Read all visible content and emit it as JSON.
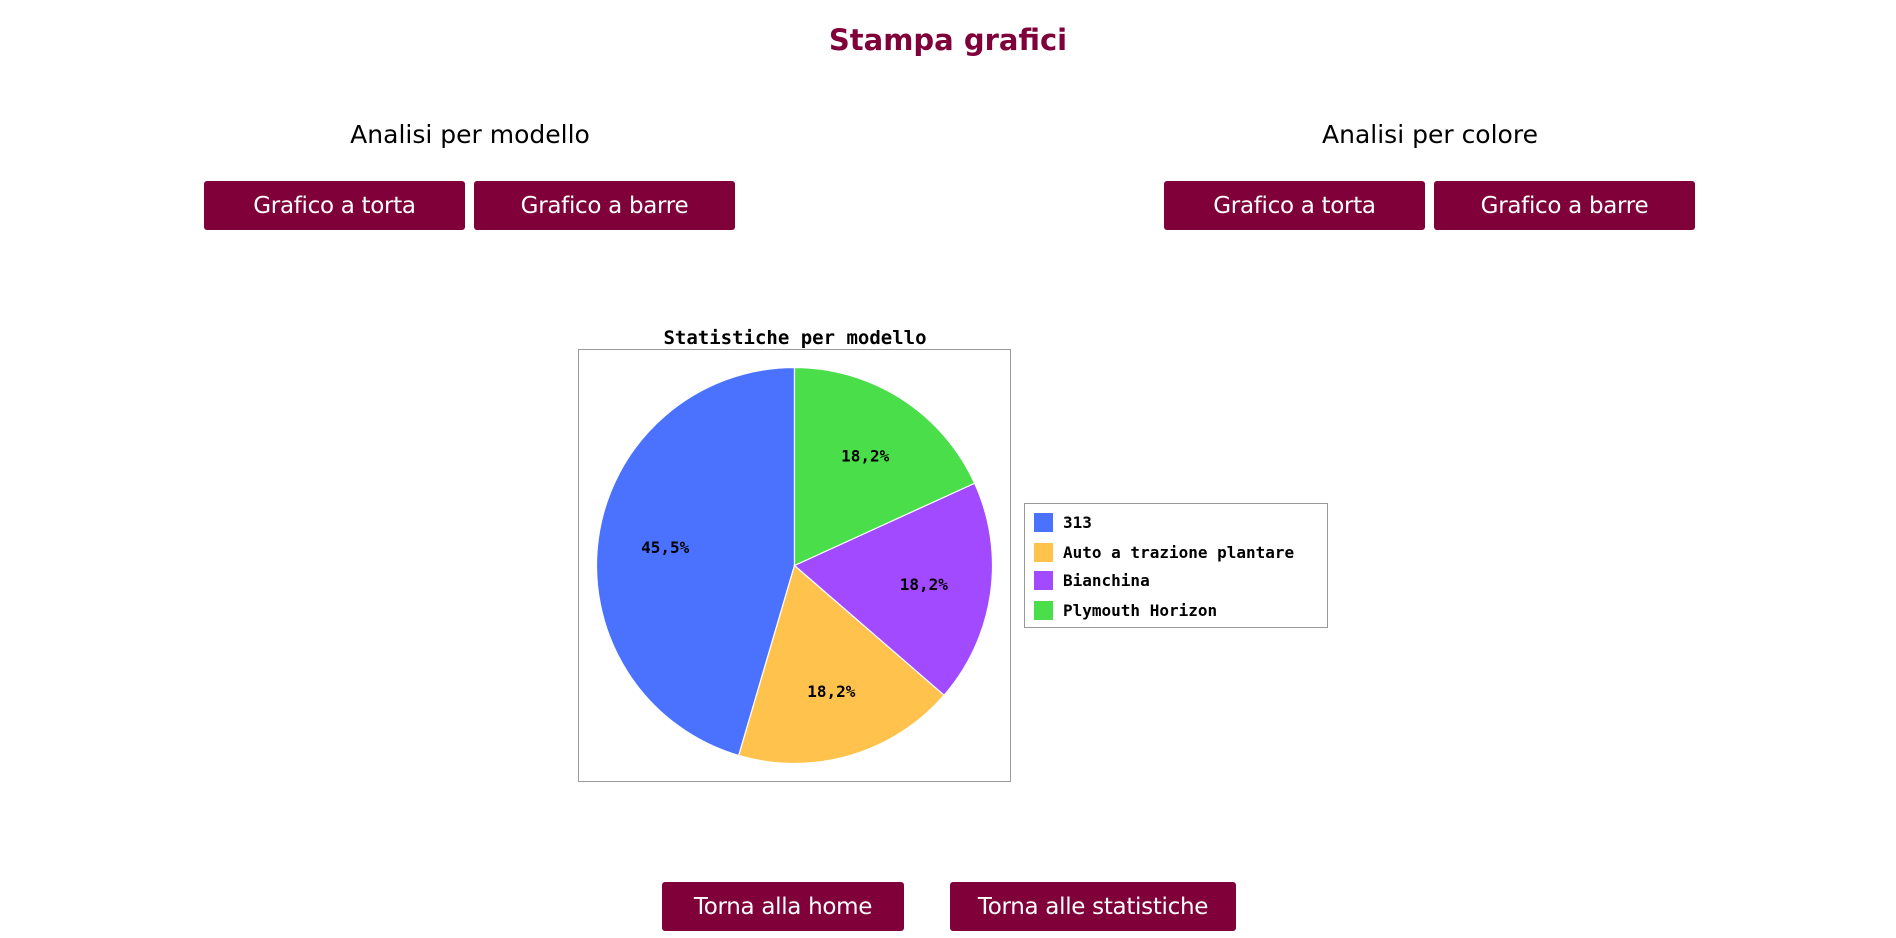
{
  "page": {
    "title": "Stampa grafici"
  },
  "model_section": {
    "heading": "Analisi per modello",
    "pie_button": "Grafico a torta",
    "bar_button": "Grafico a barre"
  },
  "color_section": {
    "heading": "Analisi per colore",
    "pie_button": "Grafico a torta",
    "bar_button": "Grafico a barre"
  },
  "footer": {
    "home_button": "Torna alla home",
    "stats_button": "Torna alle statistiche"
  },
  "colors": {
    "accent": "#80003a",
    "button_text": "#ffffff"
  },
  "chart_data": {
    "type": "pie",
    "title": "Statistiche per modello",
    "legend_position": "right",
    "slices": [
      {
        "label": "313",
        "value": 45.5,
        "display": "45,5%",
        "color": "#4a72ff"
      },
      {
        "label": "Auto a trazione plantare",
        "value": 18.2,
        "display": "18,2%",
        "color": "#ffc34d"
      },
      {
        "label": "Bianchina",
        "value": 18.2,
        "display": "18,2%",
        "color": "#a24aff"
      },
      {
        "label": "Plymouth Horizon",
        "value": 18.2,
        "display": "18,2%",
        "color": "#4bde4b"
      }
    ]
  }
}
